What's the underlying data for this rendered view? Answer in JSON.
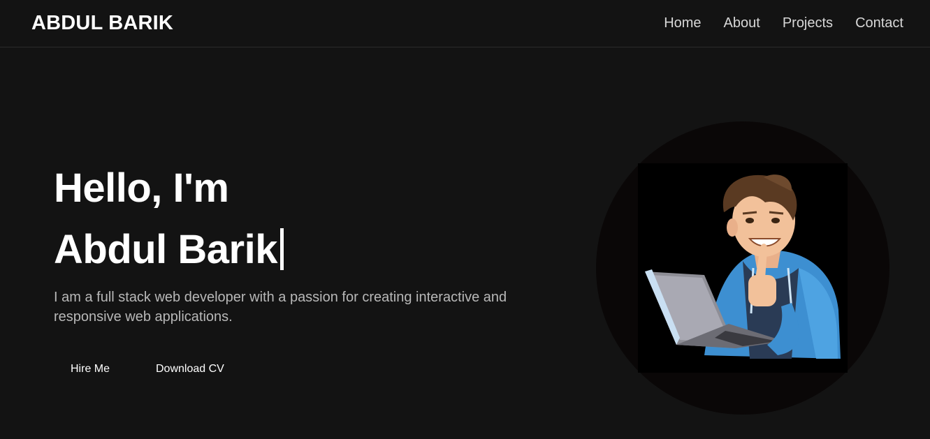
{
  "nav": {
    "brand": "ABDUL BARIK",
    "links": [
      "Home",
      "About",
      "Projects",
      "Contact"
    ]
  },
  "hero": {
    "greeting": "Hello, I'm",
    "name": "Abdul Barik",
    "description": "I am a full stack web developer with a passion for creating interactive and responsive web applications.",
    "hire_label": "Hire Me",
    "cv_label": "Download CV"
  },
  "colors": {
    "background": "#131313",
    "text": "#ffffff",
    "muted_text": "#b8b8b8",
    "avatar_bg": "#0a0707"
  }
}
